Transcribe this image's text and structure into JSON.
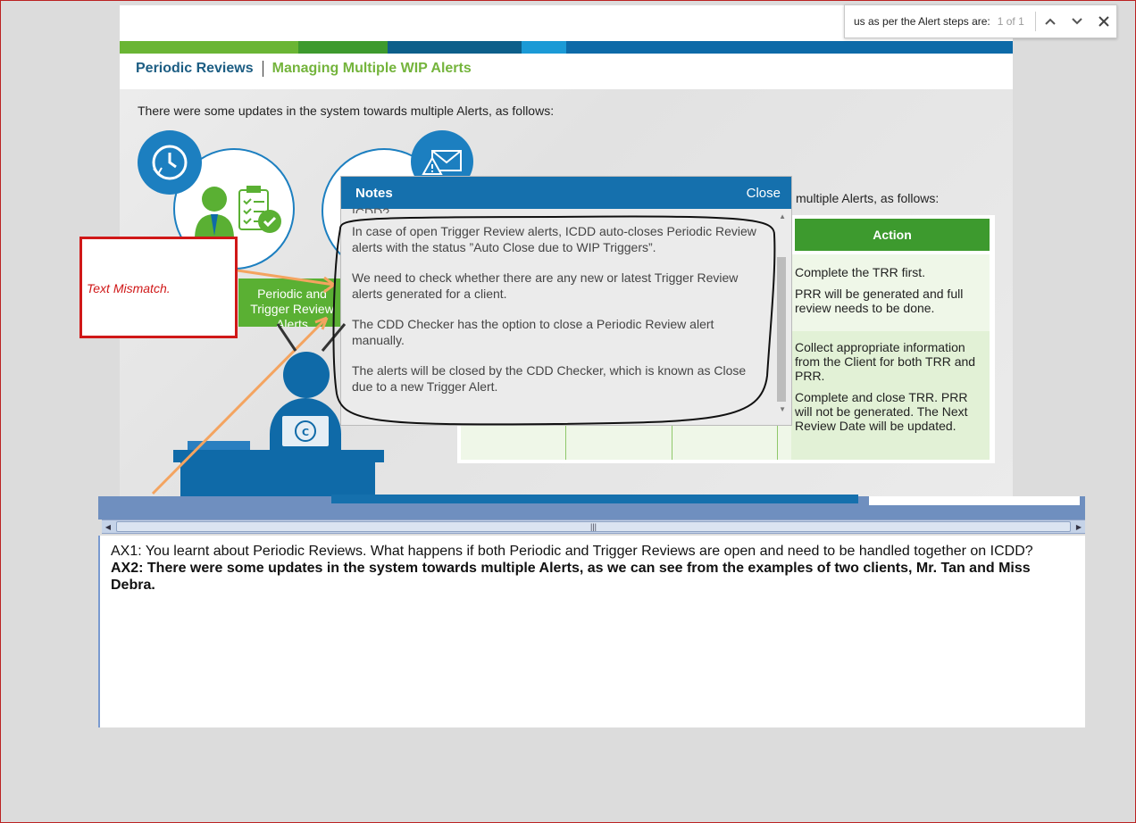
{
  "find_bar": {
    "query": "us as per the Alert steps are:",
    "count": "1 of 1"
  },
  "course": {
    "breadcrumb_section": "Periodic Reviews",
    "breadcrumb_page": "Managing Multiple WIP Alerts",
    "intro": "There were some updates in the system towards multiple Alerts, as follows:",
    "color_bar": [
      "#6ab534",
      "#3d9a2e",
      "#0d5f8a",
      "#1b9ad6",
      "#0d6aa8"
    ],
    "green_button_label": "Periodic and Trigger Review Alerts",
    "right_intro": "multiple Alerts, as follows:",
    "table": {
      "action_header": "Action",
      "row1_lines": [
        "Complete the TRR first.",
        "PRR will be generated and full review needs to be done."
      ],
      "row2_lines": [
        "Collect appropriate information from the Client for both TRR and PRR.",
        "Complete and close TRR. PRR will not be generated. The Next Review Date will be updated."
      ]
    }
  },
  "notes": {
    "title": "Notes",
    "close_label": "Close",
    "cut_text": "ICDD?",
    "paragraphs": [
      "In case of open Trigger Review alerts, ICDD auto-closes Periodic Review alerts with the status ”Auto Close due to WIP Triggers”.",
      "We need to check whether there are any new or latest Trigger Review alerts generated for a client.",
      "The CDD Checker has the option to close a Periodic Review alert manually.",
      "The alerts will be closed by the CDD Checker, which is known as Close due to a new Trigger Alert."
    ]
  },
  "annotation": {
    "text": "Text Mismatch.",
    "color": "#d01818"
  },
  "transcript": {
    "ax1": "AX1: You learnt about Periodic Reviews. What happens if both Periodic and Trigger Reviews are open and need to be handled together on ICDD?",
    "ax2": "AX2: There were some updates in the system towards multiple Alerts, as we can see from the examples of two clients, Mr. Tan and Miss Debra."
  },
  "icons": {
    "find_prev": "chevron-up-icon",
    "find_next": "chevron-down-icon",
    "find_close": "close-icon",
    "clock": "clock-icon",
    "alert_mail": "alert-mail-icon",
    "checklist": "checklist-icon"
  }
}
